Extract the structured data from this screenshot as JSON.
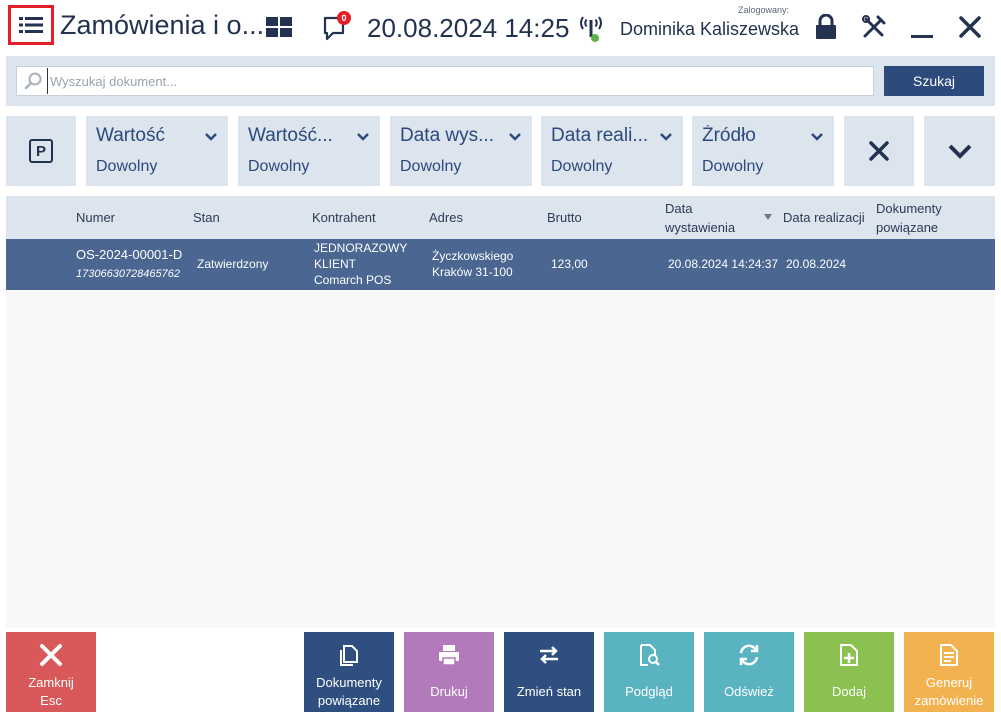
{
  "header": {
    "title": "Zamówienia i o...",
    "notification_count": "0",
    "datetime": "20.08.2024 14:25",
    "login_label": "Zalogowany:",
    "user_name": "Dominika Kaliszewska"
  },
  "search": {
    "placeholder": "Wyszukaj dokument...",
    "value": "",
    "button_label": "Szukaj"
  },
  "filters": [
    {
      "title": "Wartość",
      "value": "Dowolny"
    },
    {
      "title": "Wartość...",
      "value": "Dowolny"
    },
    {
      "title": "Data wys...",
      "value": "Dowolny"
    },
    {
      "title": "Data reali...",
      "value": "Dowolny"
    },
    {
      "title": "Źródło",
      "value": "Dowolny"
    }
  ],
  "table": {
    "columns": {
      "numer": "Numer",
      "stan": "Stan",
      "kontrahent": "Kontrahent",
      "adres": "Adres",
      "brutto": "Brutto",
      "data_wystawienia_1": "Data",
      "data_wystawienia_2": "wystawienia",
      "data_realizacji": "Data realizacji",
      "dokumenty_1": "Dokumenty",
      "dokumenty_2": "powiązane"
    },
    "rows": [
      {
        "numer": "OS-2024-00001-D",
        "numer_sub": "17306630728465762",
        "stan": "Zatwierdzony",
        "kontrahent_1": "JEDNORAZOWY",
        "kontrahent_2": "KLIENT",
        "kontrahent_3": "Comarch POS",
        "adres_1": "Życzkowskiego",
        "adres_2": "Kraków 31-100",
        "brutto": "123,00",
        "data_wystawienia": "20.08.2024 14:24:37",
        "data_realizacji": "20.08.2024",
        "dokumenty": ""
      }
    ]
  },
  "footer": {
    "close": {
      "line1": "Zamknij",
      "line2": "Esc"
    },
    "related": {
      "line1": "Dokumenty",
      "line2": "powiązane"
    },
    "print": {
      "label": "Drukuj"
    },
    "change_state": {
      "label": "Zmień stan"
    },
    "preview": {
      "label": "Podgląd"
    },
    "refresh": {
      "label": "Odśwież"
    },
    "add": {
      "label": "Dodaj"
    },
    "generate": {
      "line1": "Generuj",
      "line2": "zamówienie"
    }
  },
  "colors": {
    "primary": "#233250",
    "accent": "#2c4a7c",
    "selected_row": "#4a6691",
    "panel": "#dce4ee",
    "close_btn": "#d9585a",
    "related_btn": "#2e4f7f",
    "print_btn": "#b37abb",
    "change_state_btn": "#2e4f7f",
    "preview_btn": "#5ab3c0",
    "refresh_btn": "#5ab3c0",
    "add_btn": "#8ac150",
    "generate_btn": "#f2b250",
    "badge": "#e41e26"
  },
  "icons": {
    "menu": "list-menu-icon",
    "tiles": "tiles-icon",
    "notifications": "chat-bubble-icon",
    "signal": "signal-icon",
    "lock": "lock-icon",
    "tools": "tools-icon",
    "minimize": "minimize-icon",
    "close": "close-icon"
  }
}
